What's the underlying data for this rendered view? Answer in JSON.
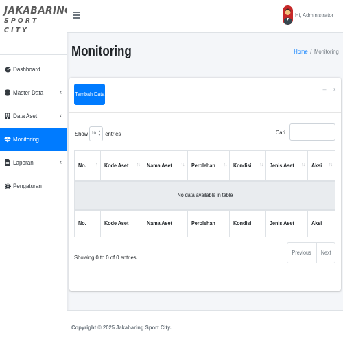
{
  "brand": {
    "title": "JAKABARING",
    "subtitle": "SPORT CITY"
  },
  "sidebar": {
    "items": [
      {
        "label": "Dashboard",
        "icon": "dashboard-icon"
      },
      {
        "label": "Master Data",
        "icon": "database-icon",
        "has_children": true
      },
      {
        "label": "Data Aset",
        "icon": "building-icon",
        "has_children": true
      },
      {
        "label": "Monitoring",
        "icon": "heartbeat-icon",
        "active": true
      },
      {
        "label": "Laporan",
        "icon": "file-icon",
        "has_children": true
      },
      {
        "label": "Pengaturan",
        "icon": "gear-icon"
      }
    ]
  },
  "topbar": {
    "menu_icon": "hamburger-icon",
    "user_name": "Hi, Administrator"
  },
  "page": {
    "title": "Monitoring"
  },
  "breadcrumb": {
    "home": "Home",
    "separator": "/",
    "current": "Monitoring"
  },
  "card": {
    "add_button": "Tambah Data",
    "tools": {
      "collapse": "–",
      "close": "x"
    }
  },
  "table": {
    "show_prefix": "Show",
    "page_size": "10",
    "show_suffix": "entries",
    "search_label": "Cari",
    "columns": [
      "No.",
      "Kode Aset",
      "Nama Aset",
      "Perolehan",
      "Kondisi",
      "Jenis Aset",
      "Aksi"
    ],
    "empty_text": "No data available in table",
    "info": "Showing 0 to 0 of 0 entries",
    "pager": {
      "previous": "Previous",
      "next": "Next"
    }
  },
  "footer": {
    "copyright": "Copyright © 2025 Jakabaring Sport City."
  },
  "colors": {
    "primary": "#007bff",
    "background": "#f4f6f9",
    "sidebar": "#ffffff"
  }
}
